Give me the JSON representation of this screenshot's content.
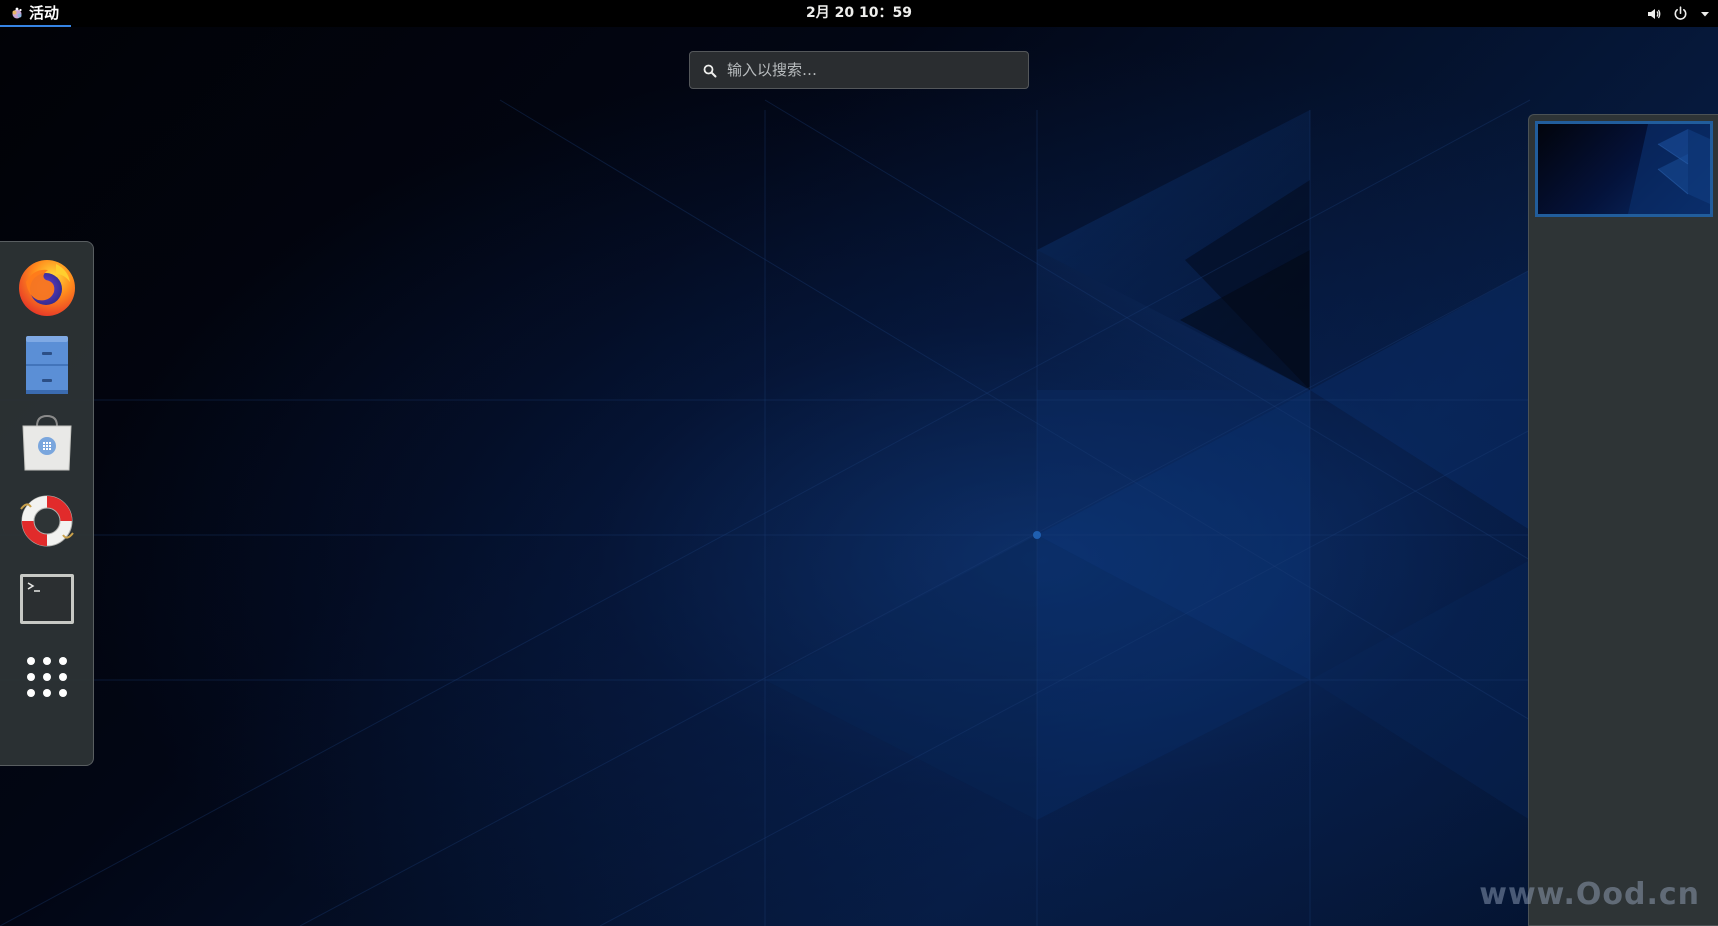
{
  "top_bar": {
    "activities_label": "活动",
    "clock": "2月 20  10：59",
    "icons": [
      "volume-icon",
      "power-icon",
      "menu-arrow-icon"
    ]
  },
  "search": {
    "placeholder": "输入以搜索…",
    "value": ""
  },
  "dash": {
    "items": [
      {
        "name": "firefox",
        "icon": "firefox-icon"
      },
      {
        "name": "files",
        "icon": "file-cabinet-icon"
      },
      {
        "name": "software",
        "icon": "software-bag-icon"
      },
      {
        "name": "help",
        "icon": "lifebuoy-icon"
      },
      {
        "name": "terminal",
        "icon": "terminal-icon"
      },
      {
        "name": "show-applications",
        "icon": "app-grid-icon"
      }
    ]
  },
  "workspaces": {
    "count": 1,
    "active": 1
  },
  "watermark": "www.Ood.cn",
  "colors": {
    "accent": "#3584e4",
    "panel": "#2e3436",
    "wallpaper_blue": "#0b2f6e"
  }
}
